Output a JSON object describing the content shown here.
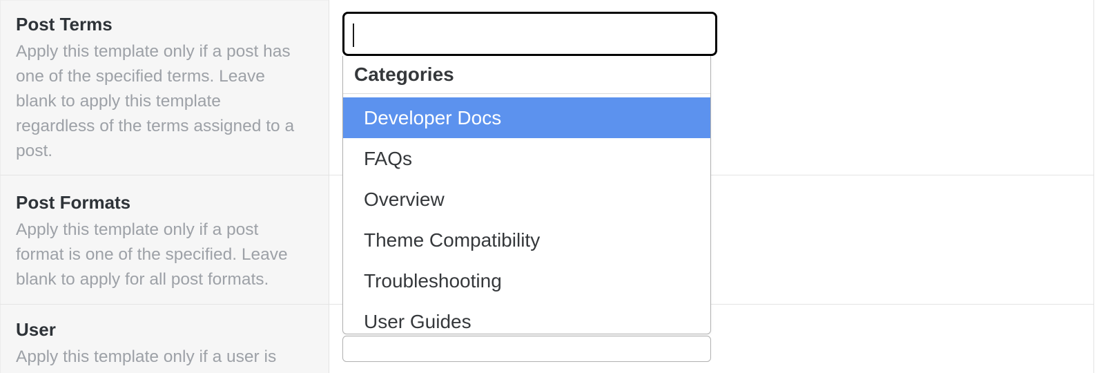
{
  "form": {
    "rows": [
      {
        "label": "Post Terms",
        "description": "Apply this template only if a post has\none of the specified terms. Leave\nblank to apply this template\nregardless of the terms assigned to a\npost."
      },
      {
        "label": "Post Formats",
        "description": "Apply this template only if a post\nformat is one of the specified. Leave\nblank to apply for all post formats."
      },
      {
        "label": "User",
        "description": "Apply this template only if a user is"
      }
    ]
  },
  "post_terms_field": {
    "search_input": {
      "value": "",
      "placeholder": ""
    },
    "dropdown": {
      "group_label": "Categories",
      "options": [
        {
          "label": "Developer Docs",
          "highlighted": true
        },
        {
          "label": "FAQs",
          "highlighted": false
        },
        {
          "label": "Overview",
          "highlighted": false
        },
        {
          "label": "Theme Compatibility",
          "highlighted": false
        },
        {
          "label": "Troubleshooting",
          "highlighted": false
        },
        {
          "label": "User Guides",
          "highlighted": false
        }
      ]
    }
  },
  "user_field": {
    "value": ""
  },
  "colors": {
    "highlight": "#5C92EE",
    "highlight_text": "#FFFFFF",
    "focus_border": "#000000",
    "panel_border": "#B0B0B0",
    "row_divider": "#E4E4E4",
    "label_column_bg": "#F6F6F6",
    "heading_text": "#2E3338",
    "description_text": "#9DA1A7",
    "option_text": "#35383B"
  }
}
